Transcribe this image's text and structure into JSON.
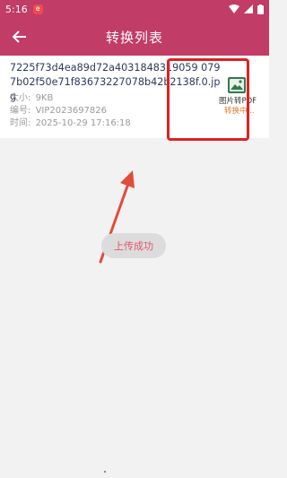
{
  "status_bar": {
    "time": "5:16",
    "badge": "e"
  },
  "header": {
    "title": "转换列表"
  },
  "file_item": {
    "name": "7225f73d4ea89d72a4031848319059 0797b02f50e71f83673227078b42b2138f.0.jpg",
    "size_label": "大小:",
    "size_value": "9KB",
    "id_label": "编号:",
    "id_value": "VIP2023697826",
    "time_label": "时间:",
    "time_value": "2025-10-29 17:16:18",
    "type_label": "图片转PDF",
    "status": "转换中..."
  },
  "toast": {
    "message": "上传成功"
  },
  "colors": {
    "primary": "#c13c67",
    "highlight": "#e02020",
    "status": "#e07a2e"
  }
}
